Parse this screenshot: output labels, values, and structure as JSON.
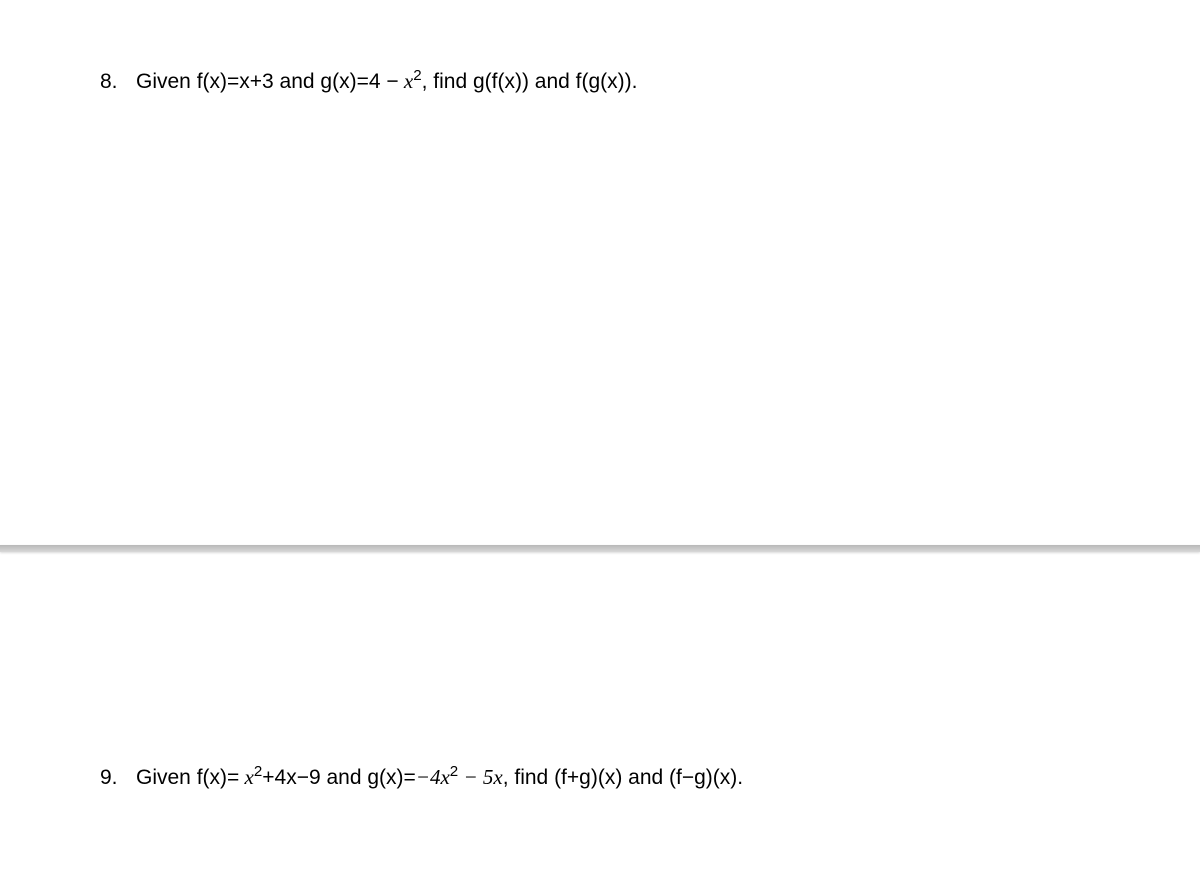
{
  "problems": {
    "p8": {
      "number": "8.",
      "text_prefix": "Given f(x)=x+3 and g(x)=4 −",
      "math_part": " 𝑥²",
      "text_suffix": ", find g(f(x)) and f(g(x)).",
      "full_plain": "Given f(x)=x+3 and g(x)=4 − x², find g(f(x)) and f(g(x))."
    },
    "p9": {
      "number": "9.",
      "text_prefix": "Given f(x)=",
      "math_part1": " 𝑥²",
      "text_mid1": "+4x−9 and g(x)=",
      "math_part2": "−4𝑥² − 5𝑥",
      "text_suffix": ", find (f+g)(x) and (f−g)(x).",
      "full_plain": "Given f(x)= x²+4x−9 and g(x)=−4x² − 5x, find (f+g)(x) and (f−g)(x)."
    }
  }
}
